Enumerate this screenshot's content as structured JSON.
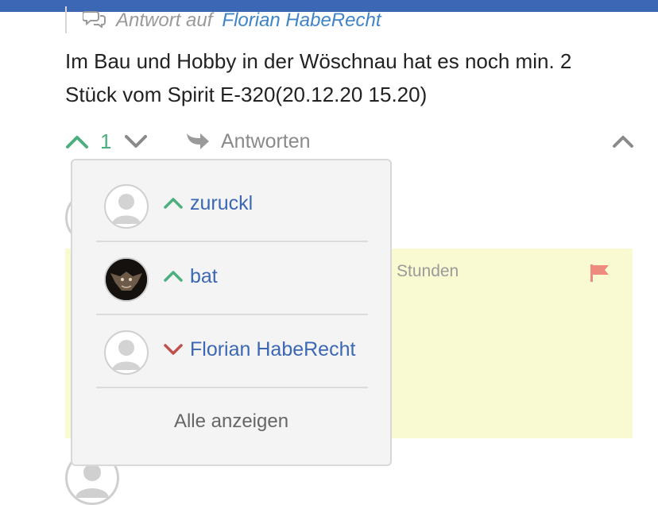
{
  "reply_header": {
    "prefix": "Antwort auf",
    "author_link": "Florian HabeRecht",
    "icon": "comment-icon"
  },
  "comment": {
    "text": "Im Bau und Hobby in der Wöschnau hat es noch min. 2 Stück vom Spirit E-320(20.12.20 15.20)"
  },
  "actions": {
    "vote_count": "1",
    "reply_label": "Antworten",
    "upvote_color": "#4caf7d",
    "downvote_color": "#c0504d"
  },
  "background": {
    "timestamp_fragment": "Stunden",
    "highlight_color": "#fafad2",
    "flag_color": "#ec8b7e"
  },
  "voters_popover": {
    "voters": [
      {
        "name": "zuruckl",
        "vote": "up",
        "avatar": "default-avatar-icon"
      },
      {
        "name": "bat",
        "vote": "up",
        "avatar": "bat-photo-avatar"
      },
      {
        "name": "Florian HabeRecht",
        "vote": "down",
        "avatar": "default-avatar-icon"
      }
    ],
    "show_all_label": "Alle anzeigen"
  },
  "colors": {
    "accent": "#3b67b5",
    "link": "#3f84c8"
  }
}
